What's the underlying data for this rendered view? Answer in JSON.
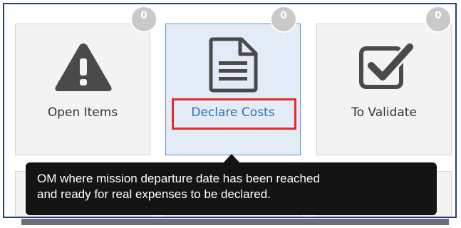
{
  "tiles": [
    {
      "label": "Open Items",
      "badge": "0",
      "icon": "warning-icon"
    },
    {
      "label": "Declare Costs",
      "badge": "0",
      "icon": "document-icon",
      "selected": true
    },
    {
      "label": "To Validate",
      "badge": "0",
      "icon": "checkbox-icon"
    }
  ],
  "tooltip": {
    "line1": "OM where mission departure date has been reached",
    "line2": "and ready for real expenses to be declared."
  },
  "colors": {
    "tile_background": "#f3f3f3",
    "selected_background": "#e3ebf6",
    "selected_border": "#5b8ec9",
    "selected_label": "#2a6fb5",
    "highlight_box": "#e52b2b",
    "badge": "#c9c9c9",
    "icon": "#4a4a4a",
    "frame": "#2a3a8a",
    "tooltip_background": "#141414"
  }
}
